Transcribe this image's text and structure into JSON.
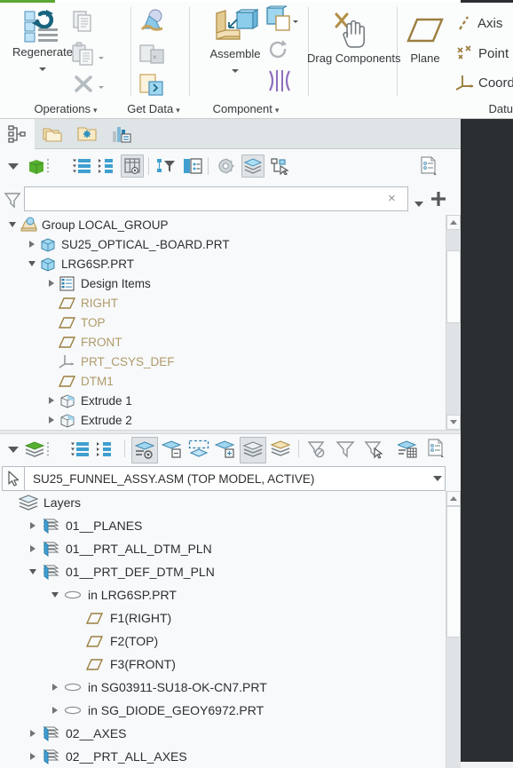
{
  "ribbon": {
    "groups": [
      {
        "name": "operations",
        "label": "Operations",
        "has_caret": true,
        "buttons": [
          {
            "name": "regenerate",
            "label": "Regenerate",
            "icon": "regenerate-icon",
            "has_caret": true
          },
          {
            "name": "copy",
            "label": "",
            "icon": "copy-icon",
            "disabled": true
          },
          {
            "name": "paste",
            "label": "",
            "icon": "paste-icon",
            "disabled": true,
            "has_caret": true
          },
          {
            "name": "delete",
            "label": "",
            "icon": "delete-x-icon",
            "disabled": true,
            "has_caret": true
          }
        ]
      },
      {
        "name": "get-data",
        "label": "Get Data",
        "has_caret": true,
        "buttons": [
          {
            "name": "import",
            "label": "",
            "icon": "import-icon"
          },
          {
            "name": "merge-inheritance",
            "label": "",
            "icon": "merge-inheritance-icon",
            "disabled": true
          },
          {
            "name": "shrinkwrap",
            "label": "",
            "icon": "shrinkwrap-icon"
          }
        ]
      },
      {
        "name": "component",
        "label": "Component",
        "has_caret": true,
        "buttons": [
          {
            "name": "assemble",
            "label": "Assemble",
            "icon": "assemble-icon",
            "has_caret": true
          },
          {
            "name": "create",
            "label": "",
            "icon": "create-component-icon",
            "has_caret": true
          },
          {
            "name": "repeat",
            "label": "",
            "icon": "repeat-icon",
            "disabled": true
          },
          {
            "name": "mirror-component",
            "label": "",
            "icon": "mirror-component-icon"
          }
        ]
      },
      {
        "name": "drag",
        "label": "",
        "has_caret": false,
        "buttons": [
          {
            "name": "drag-components",
            "label": "Drag Components",
            "icon": "drag-hand-icon"
          }
        ]
      },
      {
        "name": "datum",
        "label": "Datu",
        "has_caret": false,
        "buttons": [
          {
            "name": "plane",
            "label": "Plane",
            "icon": "datum-plane-icon"
          },
          {
            "name": "axis",
            "label": "Axis",
            "icon": "datum-axis-icon"
          },
          {
            "name": "point",
            "label": "Point",
            "icon": "datum-point-icon",
            "has_caret": true
          },
          {
            "name": "coordinate-system",
            "label": "Coordin",
            "icon": "datum-csys-icon"
          }
        ]
      }
    ]
  },
  "navigator": {
    "tabs": [
      {
        "name": "model-tree-tab",
        "icon": "model-tree-icon",
        "active": true
      },
      {
        "name": "folder-browser-tab",
        "icon": "folder-browser-icon",
        "active": false
      },
      {
        "name": "favorites-tab",
        "icon": "favorites-folder-icon",
        "active": false
      },
      {
        "name": "history-tab",
        "icon": "history-chart-icon",
        "active": false
      }
    ]
  },
  "model_tree": {
    "toolbar": {
      "buttons": [
        {
          "name": "model-tree-dropdown",
          "icon": "chevron-down-icon"
        },
        {
          "name": "model-display-icon",
          "icon": "green-cube-icon"
        },
        {
          "name": "tree-handle",
          "icon": "drag-dots-icon"
        },
        {
          "name": "expand-all",
          "icon": "expand-all-icon"
        },
        {
          "name": "collapse-all",
          "icon": "collapse-all-icon"
        },
        {
          "name": "tree-columns",
          "icon": "tree-columns-icon",
          "toggled": true
        },
        {
          "name": "tree-filters",
          "icon": "tree-filter-icon"
        },
        {
          "name": "tree-search",
          "icon": "tree-search-icon"
        },
        {
          "name": "settings",
          "icon": "gear-icon"
        },
        {
          "name": "layers-toggle",
          "icon": "layers-icon",
          "toggled": true
        },
        {
          "name": "select-by-tree",
          "icon": "select-tree-icon"
        },
        {
          "name": "tree-info",
          "icon": "document-info-icon"
        }
      ]
    },
    "filter": {
      "icon": "funnel-icon",
      "value": "",
      "placeholder": "",
      "clear_label": "×",
      "dropdown_icon": "chevron-down-icon",
      "add_icon": "plus-icon"
    },
    "items": [
      {
        "label": "Group LOCAL_GROUP",
        "indent": 0,
        "arrow": "expanded",
        "icon": "group-icon",
        "dim": false
      },
      {
        "label": "SU25_OPTICAL_-BOARD.PRT",
        "indent": 1,
        "arrow": "collapsed",
        "icon": "part-icon",
        "dim": false
      },
      {
        "label": "LRG6SP.PRT",
        "indent": 1,
        "arrow": "expanded",
        "icon": "part-icon",
        "dim": false
      },
      {
        "label": "Design Items",
        "indent": 2,
        "arrow": "collapsed",
        "icon": "design-items-icon",
        "dim": false
      },
      {
        "label": "RIGHT",
        "indent": 2,
        "arrow": "none",
        "icon": "plane-icon",
        "dim": true
      },
      {
        "label": "TOP",
        "indent": 2,
        "arrow": "none",
        "icon": "plane-icon",
        "dim": true
      },
      {
        "label": "FRONT",
        "indent": 2,
        "arrow": "none",
        "icon": "plane-icon",
        "dim": true
      },
      {
        "label": "PRT_CSYS_DEF",
        "indent": 2,
        "arrow": "none",
        "icon": "csys-icon",
        "dim": true
      },
      {
        "label": "DTM1",
        "indent": 2,
        "arrow": "none",
        "icon": "plane-icon",
        "dim": true
      },
      {
        "label": "Extrude 1",
        "indent": 2,
        "arrow": "collapsed",
        "icon": "extrude-icon",
        "dim": false
      },
      {
        "label": "Extrude 2",
        "indent": 2,
        "arrow": "collapsed",
        "icon": "extrude-icon",
        "dim": false
      }
    ]
  },
  "layers": {
    "toolbar": {
      "buttons": [
        {
          "name": "layers-dropdown",
          "icon": "chevron-down-icon"
        },
        {
          "name": "layers-display",
          "icon": "green-layers-icon"
        },
        {
          "name": "layers-handle",
          "icon": "drag-dots-icon"
        },
        {
          "name": "expand-all",
          "icon": "expand-all-icon"
        },
        {
          "name": "collapse-all",
          "icon": "collapse-all-icon"
        },
        {
          "name": "layer-properties",
          "icon": "layer-properties-icon",
          "toggled": true
        },
        {
          "name": "new-layer",
          "icon": "new-layer-icon"
        },
        {
          "name": "layer-select",
          "icon": "layer-dashed-icon"
        },
        {
          "name": "layer-item-add",
          "icon": "layer-add-item-icon"
        },
        {
          "name": "show-layers",
          "icon": "show-layers-icon",
          "toggled": true
        },
        {
          "name": "hide-layers",
          "icon": "hide-layers-icon"
        },
        {
          "name": "unhide-all",
          "icon": "filter-off-icon"
        },
        {
          "name": "isolate",
          "icon": "filter-icon"
        },
        {
          "name": "filter-select",
          "icon": "filter-select-icon"
        },
        {
          "name": "layer-tree-columns",
          "icon": "layer-columns-icon"
        },
        {
          "name": "layer-info",
          "icon": "document-info-icon"
        }
      ]
    },
    "model_selector": {
      "pointer_icon": "pointer-arrow-icon",
      "value": "SU25_FUNNEL_ASSY.ASM (TOP MODEL, ACTIVE)",
      "dropdown_icon": "chevron-down-icon"
    },
    "items": [
      {
        "label": "Layers",
        "indent": 0,
        "arrow": "none",
        "icon": "layers-stack-icon"
      },
      {
        "label": "01__PLANES",
        "indent": 1,
        "arrow": "collapsed",
        "icon": "layer-icon"
      },
      {
        "label": "01__PRT_ALL_DTM_PLN",
        "indent": 1,
        "arrow": "collapsed",
        "icon": "layer-icon"
      },
      {
        "label": "01__PRT_DEF_DTM_PLN",
        "indent": 1,
        "arrow": "expanded",
        "icon": "layer-icon"
      },
      {
        "label": "in LRG6SP.PRT",
        "indent": 2,
        "arrow": "expanded",
        "icon": "sublayer-icon"
      },
      {
        "label": "F1(RIGHT)",
        "indent": 3,
        "arrow": "none",
        "icon": "plane-icon"
      },
      {
        "label": "F2(TOP)",
        "indent": 3,
        "arrow": "none",
        "icon": "plane-icon"
      },
      {
        "label": "F3(FRONT)",
        "indent": 3,
        "arrow": "none",
        "icon": "plane-icon"
      },
      {
        "label": "in SG03911-SU18-OK-CN7.PRT",
        "indent": 2,
        "arrow": "collapsed",
        "icon": "sublayer-icon"
      },
      {
        "label": "in SG_DIODE_GEOY6972.PRT",
        "indent": 2,
        "arrow": "collapsed",
        "icon": "sublayer-icon"
      },
      {
        "label": "02__AXES",
        "indent": 1,
        "arrow": "collapsed",
        "icon": "layer-icon"
      },
      {
        "label": "02__PRT_ALL_AXES",
        "indent": 1,
        "arrow": "collapsed",
        "icon": "layer-icon"
      }
    ]
  },
  "colors": {
    "accent_green": "#5aa832",
    "graphics_bg": "#2b2f31",
    "panel_bg": "#f7f9fa",
    "tab_strip_bg": "#dfe4e6",
    "datum_gold": "#9c7f3f",
    "dim_text": "#b09a6a",
    "text": "#2b2f31"
  }
}
